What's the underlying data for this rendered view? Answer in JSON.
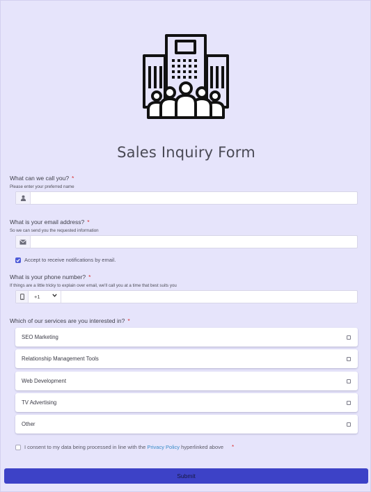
{
  "form": {
    "title": "Sales Inquiry Form",
    "logo_icon": "office-building-people-icon",
    "required_marker": "*",
    "name_question": {
      "label": "What can we call you?",
      "hint": "Please enter your preferred name",
      "value": "",
      "icon": "user-icon"
    },
    "email_question": {
      "label": "What is your email address?",
      "hint": "So we can send you the requested information",
      "value": "",
      "icon": "envelope-icon"
    },
    "notifications": {
      "label": "Accept to receive notifications by email.",
      "checked": true
    },
    "phone_question": {
      "label": "What is your phone number?",
      "hint": "If things are a little tricky to explain over email, we'll call you at a time that best suits you",
      "country_code": "+1",
      "value": "",
      "icon": "mobile-phone-icon"
    },
    "services_question": {
      "label": "Which of our services are you interested in?",
      "options": [
        {
          "label": "SEO Marketing",
          "checked": false
        },
        {
          "label": "Relationship Management Tools",
          "checked": false
        },
        {
          "label": "Web Development",
          "checked": false
        },
        {
          "label": "TV Advertising",
          "checked": false
        },
        {
          "label": "Other",
          "checked": false
        }
      ]
    },
    "consent": {
      "text_before": "I consent to my data being processed in line with the",
      "link_text": "Privacy Policy",
      "text_after": "hyperlinked above",
      "checked": false
    },
    "submit_label": "Submit"
  },
  "colors": {
    "background": "#e6e4fb",
    "accent": "#3d42c7",
    "checkbox_checked": "#4e5bd8",
    "required": "#d93030",
    "link": "#3a8dc8"
  }
}
